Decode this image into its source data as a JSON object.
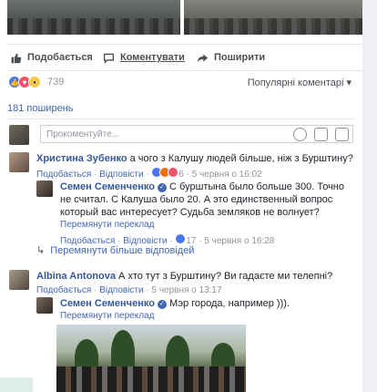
{
  "actions": {
    "like": "Подобається",
    "comment": "Коментувати",
    "share": "Поширити"
  },
  "reactions": {
    "count": "739",
    "popular": "Популярні коментарі ▾"
  },
  "shares": "181 поширень",
  "composer": {
    "placeholder": "Прокоментуйте..."
  },
  "comments": [
    {
      "author": "Христина Зубенко",
      "text": "а чого з Калушу людей більше, ніж з Бурштину?",
      "like": "Подобається",
      "replies": "Відповісти",
      "reactions": "6",
      "time": "5 червня о 16:02"
    },
    {
      "author": "Семен Семенченко",
      "text": "С бурштына было больше 300. Точно не считал. С Калуша было 20. А это единственный вопрос который вас интересует? Судьба земляков не волнует?",
      "translate": "Перемянути переклад",
      "like": "Подобається",
      "replies": "Відповісти",
      "reactions": "17",
      "time": "5 червня о 16:28"
    }
  ],
  "more_replies": "Перемянути більше відповідей",
  "comments2": [
    {
      "author": "Albina Antonova",
      "text": "А хто тут з Бурштину? Ви гадаєте ми телепні?",
      "like": "Подобається",
      "replies": "Відповісти",
      "time": "5 червня о 13:17"
    },
    {
      "author": "Семен Семенченко",
      "text": "Мэр города, например ))).",
      "translate": "Перемянути переклад"
    }
  ]
}
